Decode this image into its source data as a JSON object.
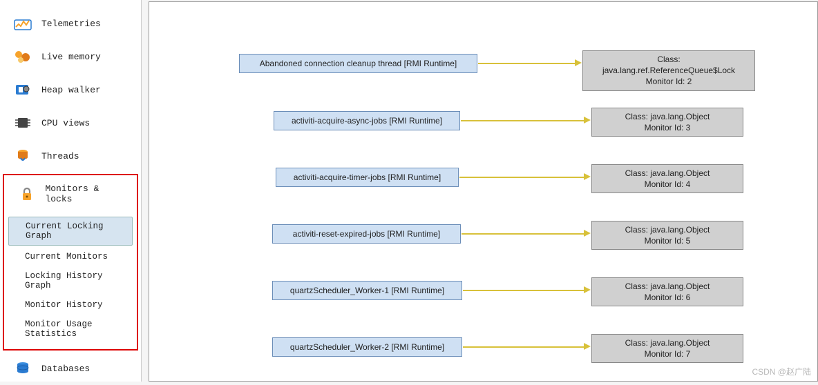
{
  "sidebar": {
    "items": [
      {
        "label": "Telemetries",
        "icon": "telemetries"
      },
      {
        "label": "Live memory",
        "icon": "livememory"
      },
      {
        "label": "Heap walker",
        "icon": "heapwalker"
      },
      {
        "label": "CPU views",
        "icon": "cpuviews"
      },
      {
        "label": "Threads",
        "icon": "threads"
      }
    ],
    "monitors_group": {
      "label": "Monitors & locks",
      "items": [
        {
          "label": "Current Locking Graph",
          "selected": true
        },
        {
          "label": "Current Monitors"
        },
        {
          "label": "Locking History Graph"
        },
        {
          "label": "Monitor History"
        },
        {
          "label": "Monitor Usage Statistics"
        }
      ]
    },
    "databases": {
      "label": "Databases"
    }
  },
  "graph": {
    "rows": [
      {
        "thread": "Abandoned connection cleanup thread [RMI Runtime]",
        "class_l1": "Class: java.lang.ref.ReferenceQueue$Lock",
        "class_l2": "Monitor Id: 2"
      },
      {
        "thread": "activiti-acquire-async-jobs [RMI Runtime]",
        "class_l1": "Class: java.lang.Object",
        "class_l2": "Monitor Id: 3"
      },
      {
        "thread": "activiti-acquire-timer-jobs [RMI Runtime]",
        "class_l1": "Class: java.lang.Object",
        "class_l2": "Monitor Id: 4"
      },
      {
        "thread": "activiti-reset-expired-jobs [RMI Runtime]",
        "class_l1": "Class: java.lang.Object",
        "class_l2": "Monitor Id: 5"
      },
      {
        "thread": "quartzScheduler_Worker-1 [RMI Runtime]",
        "class_l1": "Class: java.lang.Object",
        "class_l2": "Monitor Id: 6"
      },
      {
        "thread": "quartzScheduler_Worker-2 [RMI Runtime]",
        "class_l1": "Class: java.lang.Object",
        "class_l2": "Monitor Id: 7"
      }
    ]
  },
  "watermark": "CSDN @赵广陆"
}
